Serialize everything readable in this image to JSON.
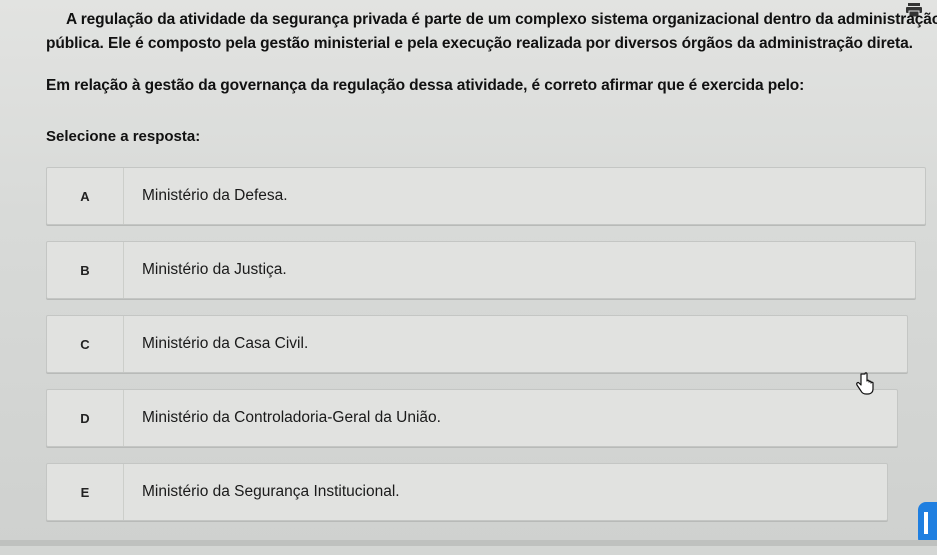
{
  "question": {
    "line1": "A regulação da atividade da segurança privada é parte de um complexo sistema organizacional dentro da administração",
    "line2": "pública. Ele é composto pela gestão ministerial e pela execução realizada por diversos órgãos da administração direta.",
    "line3": "Em relação à gestão da governança da regulação dessa atividade, é correto afirmar que é exercida pelo:"
  },
  "select_label": "Selecione a resposta:",
  "options": [
    {
      "letter": "A",
      "text": "Ministério da Defesa."
    },
    {
      "letter": "B",
      "text": "Ministério da Justiça."
    },
    {
      "letter": "C",
      "text": "Ministério da Casa Civil."
    },
    {
      "letter": "D",
      "text": "Ministério da Controladoria-Geral da União."
    },
    {
      "letter": "E",
      "text": "Ministério da Segurança Institucional."
    }
  ],
  "icons": {
    "print": "print-icon",
    "cursor": "hand-cursor-icon",
    "corner": "side-widget-icon"
  },
  "colors": {
    "accent": "#1f7fe0",
    "background": "#d8dad8",
    "option_bg": "#e1e2e0"
  }
}
